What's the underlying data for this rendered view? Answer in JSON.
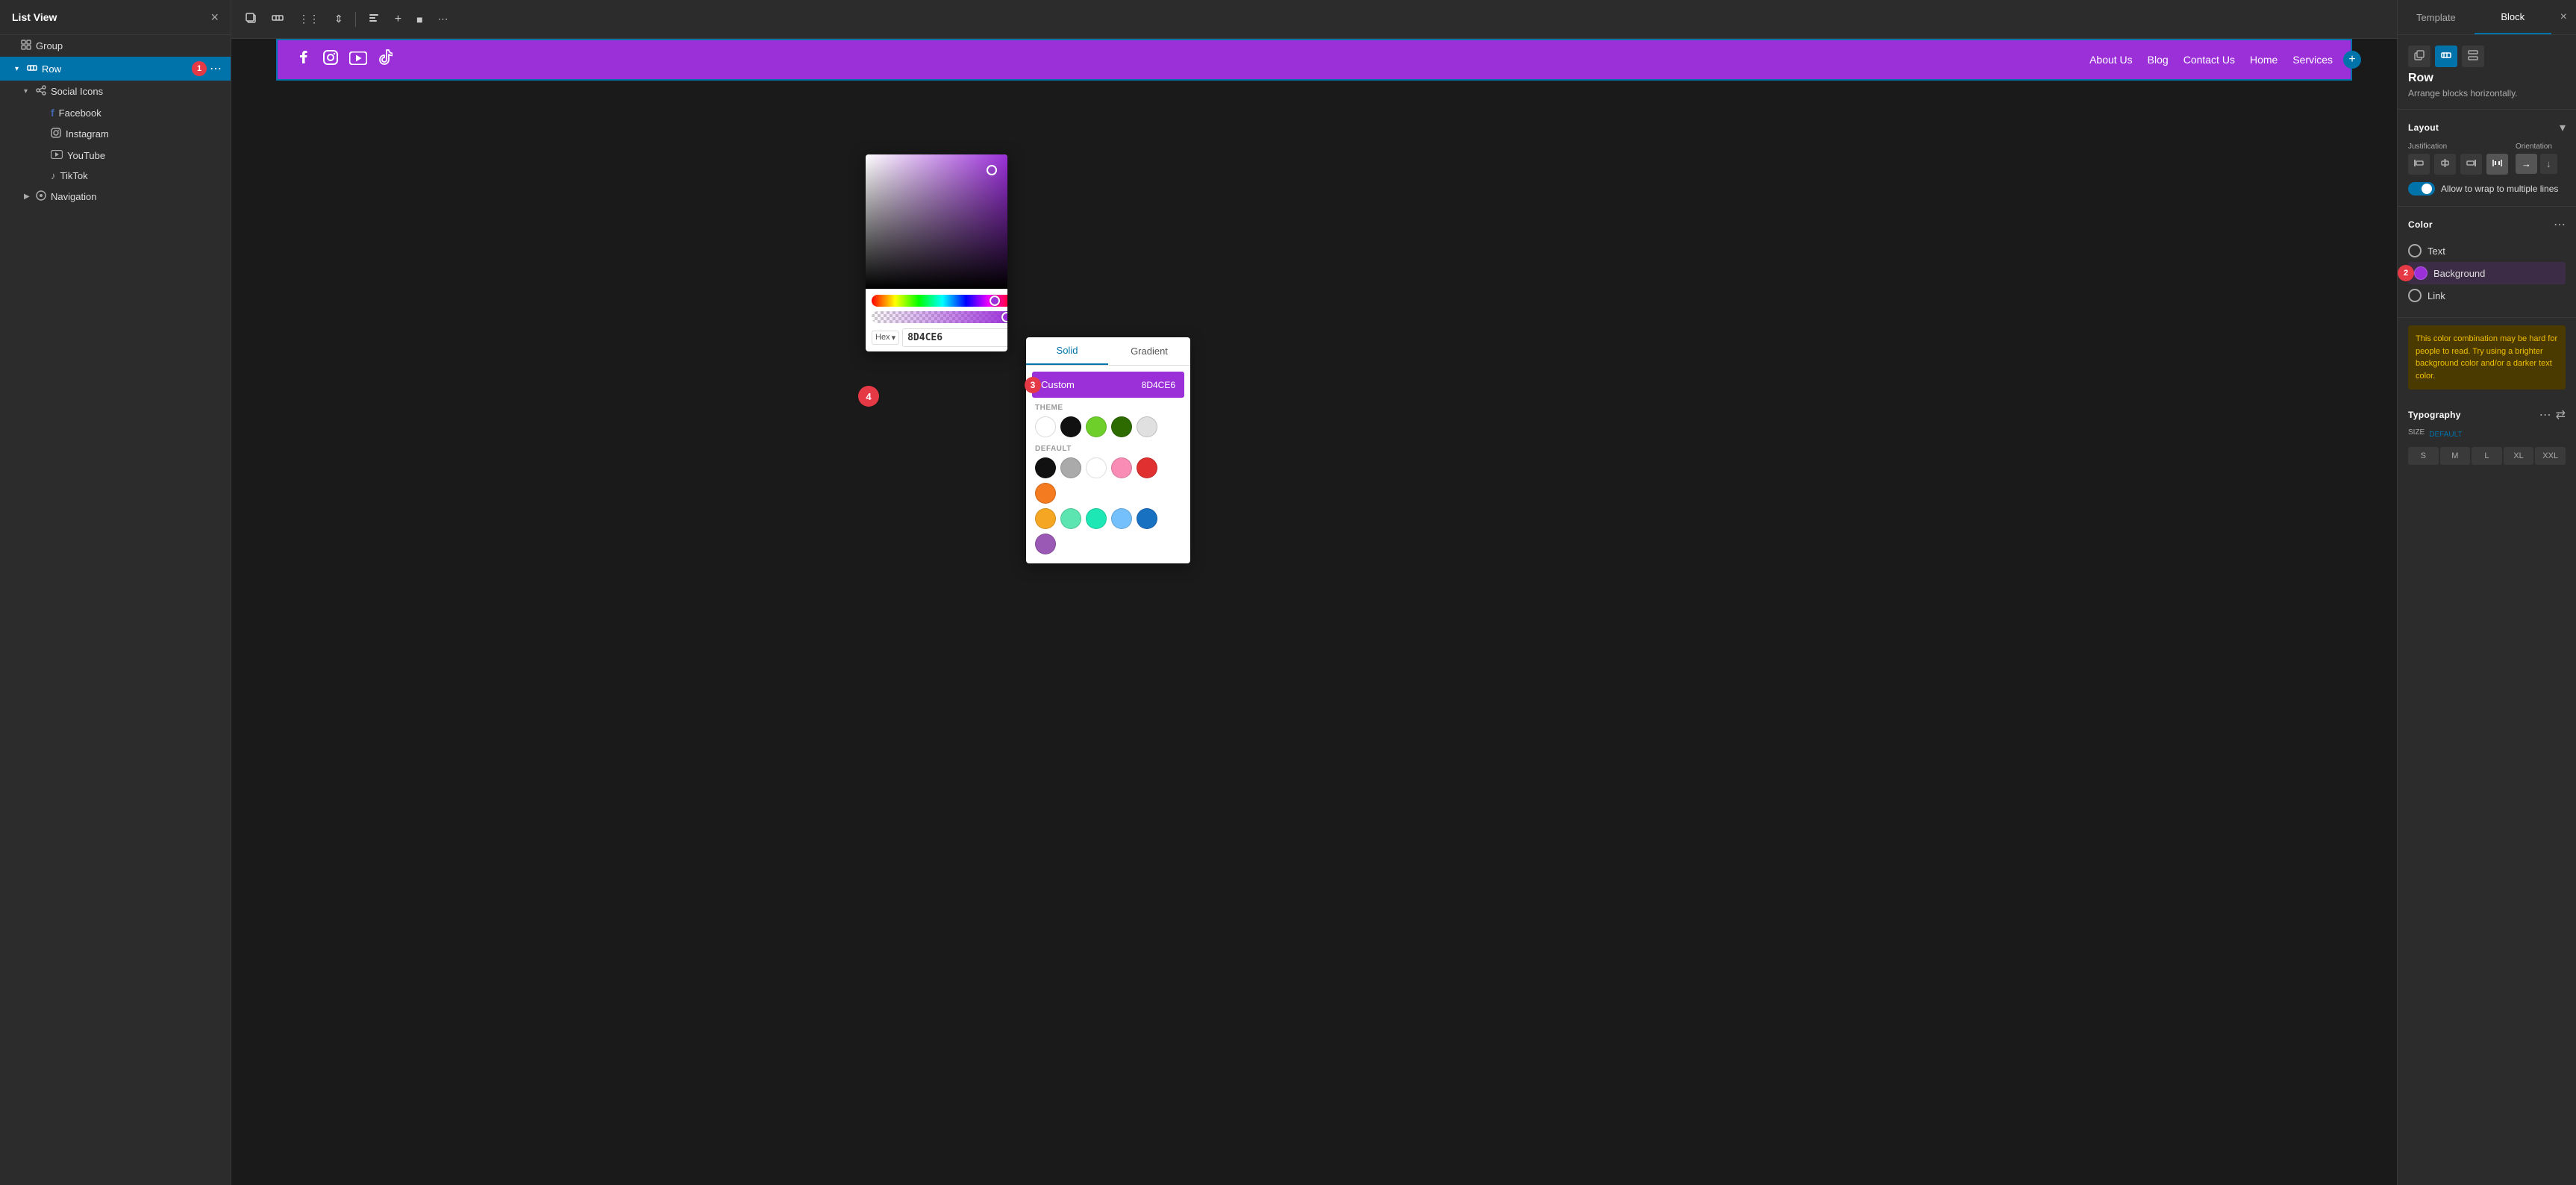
{
  "leftPanel": {
    "title": "List View",
    "closeBtn": "×",
    "items": [
      {
        "id": "group",
        "label": "Group",
        "indent": 0,
        "expand": "",
        "icon": "⊞",
        "type": "group"
      },
      {
        "id": "row",
        "label": "Row",
        "indent": 1,
        "expand": "▾",
        "icon": "⊞",
        "type": "row",
        "selected": true,
        "badge": "1"
      },
      {
        "id": "social-icons",
        "label": "Social Icons",
        "indent": 2,
        "expand": "▾",
        "icon": "✦",
        "type": "social"
      },
      {
        "id": "facebook",
        "label": "Facebook",
        "indent": 3,
        "expand": "",
        "icon": "f",
        "type": "facebook"
      },
      {
        "id": "instagram",
        "label": "Instagram",
        "indent": 3,
        "expand": "",
        "icon": "◎",
        "type": "instagram"
      },
      {
        "id": "youtube",
        "label": "YouTube",
        "indent": 3,
        "expand": "",
        "icon": "▶",
        "type": "youtube"
      },
      {
        "id": "tiktok",
        "label": "TikTok",
        "indent": 3,
        "expand": "",
        "icon": "♪",
        "type": "tiktok"
      },
      {
        "id": "navigation",
        "label": "Navigation",
        "indent": 2,
        "expand": "▶",
        "icon": "⊙",
        "type": "navigation"
      }
    ]
  },
  "toolbar": {
    "buttons": [
      "⧉",
      "⊞",
      "⋮⋮",
      "⇕",
      "⊣",
      "+",
      "■",
      "⋯"
    ]
  },
  "navbar": {
    "socialIcons": [
      "Facebook",
      "Instagram",
      "YouTube",
      "TikTok"
    ],
    "navLinks": [
      "About Us",
      "Blog",
      "Contact Us",
      "Home",
      "Services"
    ]
  },
  "colorPicker": {
    "hexLabel": "Hex",
    "hexValue": "8D4CE6",
    "eyedropperIcon": "⊕"
  },
  "sgPanel": {
    "tabs": [
      "Solid",
      "Gradient"
    ],
    "activeTab": "Solid",
    "customLabel": "Custom",
    "customValue": "8D4CE6",
    "themeTitle": "THEME",
    "defaultTitle": "DEFAULT",
    "themeColors": [
      "#fff",
      "#111",
      "#6fcf2a",
      "#2d6a00",
      "#e0e0e0"
    ],
    "defaultColors": [
      "#111",
      "#aaa",
      "#fff",
      "#f98cb4",
      "#e03030",
      "#f47b20"
    ],
    "defaultColors2": [
      "#f5a623",
      "#5ce5b0",
      "#1de8b5",
      "#74c0fc",
      "#1971c2",
      "#9b59b6"
    ],
    "badge3": "3"
  },
  "rightPanel": {
    "tabs": [
      "Template",
      "Block"
    ],
    "activeTab": "Block",
    "closeBtn": "×",
    "blockTitle": "Row",
    "blockDesc": "Arrange blocks horizontally.",
    "layoutSection": "Layout",
    "justificationLabel": "Justification",
    "orientationLabel": "Orientation",
    "justifyButtons": [
      "⊣",
      "⊢⊣",
      "⊢",
      "⊟",
      "⊞"
    ],
    "orientButtons": [
      "→",
      "↓"
    ],
    "wrapLabel": "Allow to wrap to multiple lines",
    "colorSection": "Color",
    "textLabel": "Text",
    "backgroundLabel": "Background",
    "linkLabel": "Link",
    "badge2": "2",
    "warningText": "This color combination may be hard for people to read. Try using a brighter background color and/or a darker text color.",
    "typographyLabel": "Typography",
    "sizeLabel": "SIZE",
    "sizeDefault": "DEFAULT",
    "sizeButtons": [
      "S",
      "M",
      "L",
      "XL",
      "XXL"
    ]
  }
}
